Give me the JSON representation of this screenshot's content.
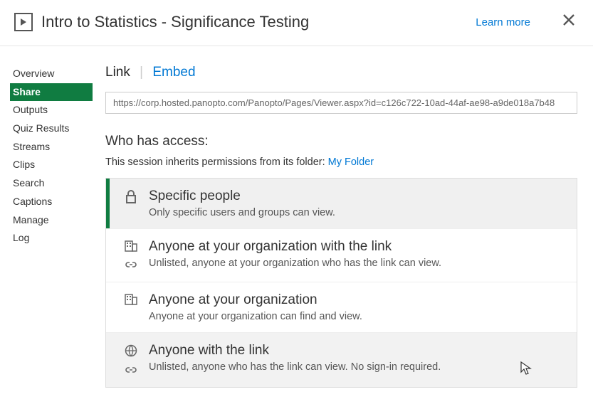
{
  "header": {
    "title": "Intro to Statistics - Significance Testing",
    "learn_more": "Learn more"
  },
  "sidebar": {
    "items": [
      {
        "label": "Overview"
      },
      {
        "label": "Share"
      },
      {
        "label": "Outputs"
      },
      {
        "label": "Quiz Results"
      },
      {
        "label": "Streams"
      },
      {
        "label": "Clips"
      },
      {
        "label": "Search"
      },
      {
        "label": "Captions"
      },
      {
        "label": "Manage"
      },
      {
        "label": "Log"
      }
    ]
  },
  "tabs": {
    "link": "Link",
    "embed": "Embed"
  },
  "url": "https://corp.hosted.panopto.com/Panopto/Pages/Viewer.aspx?id=c126c722-10ad-44af-ae98-a9de018a7b48",
  "access": {
    "heading": "Who has access:",
    "inherit_prefix": "This session inherits permissions from its folder: ",
    "folder": "My Folder",
    "options": [
      {
        "title": "Specific people",
        "desc": "Only specific users and groups can view."
      },
      {
        "title": "Anyone at your organization with the link",
        "desc": "Unlisted, anyone at your organization who has the link can view."
      },
      {
        "title": "Anyone at your organization",
        "desc": "Anyone at your organization can find and view."
      },
      {
        "title": "Anyone with the link",
        "desc": "Unlisted, anyone who has the link can view. No sign-in required."
      }
    ]
  }
}
